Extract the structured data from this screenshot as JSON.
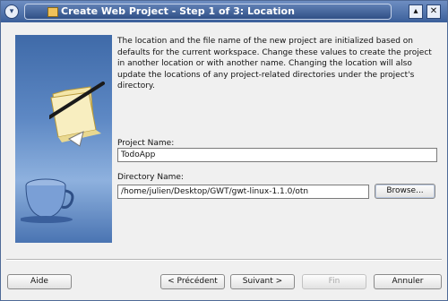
{
  "window": {
    "title": "Create Web Project - Step 1 of 3: Location",
    "menu_icon": "chevron-down-icon",
    "app_icon": "web-project-icon",
    "maximize_icon": "maximize-icon",
    "close_icon": "close-icon"
  },
  "illustration": {
    "icons": [
      "folder-with-pen-icon",
      "coffee-cup-icon"
    ]
  },
  "description": "The location and the file name of the new project are initialized based on defaults for the current workspace. Change these values to create the project in another location or with another name. Changing the location will also update the locations of any project-related directories under the project's directory.",
  "fields": {
    "project_name_label": "Project Name:",
    "project_name_value": "TodoApp",
    "directory_name_label": "Directory Name:",
    "directory_name_value": "/home/julien/Desktop/GWT/gwt-linux-1.1.0/otn",
    "browse_label": "Browse..."
  },
  "buttons": {
    "help": "Aide",
    "back": "< Précédent",
    "next": "Suivant >",
    "finish": "Fin",
    "cancel": "Annuler"
  },
  "colors": {
    "title_bar": "#3b5f9a",
    "panel_background": "#f0f0f0",
    "illustration_blue": "#5d88c4"
  }
}
